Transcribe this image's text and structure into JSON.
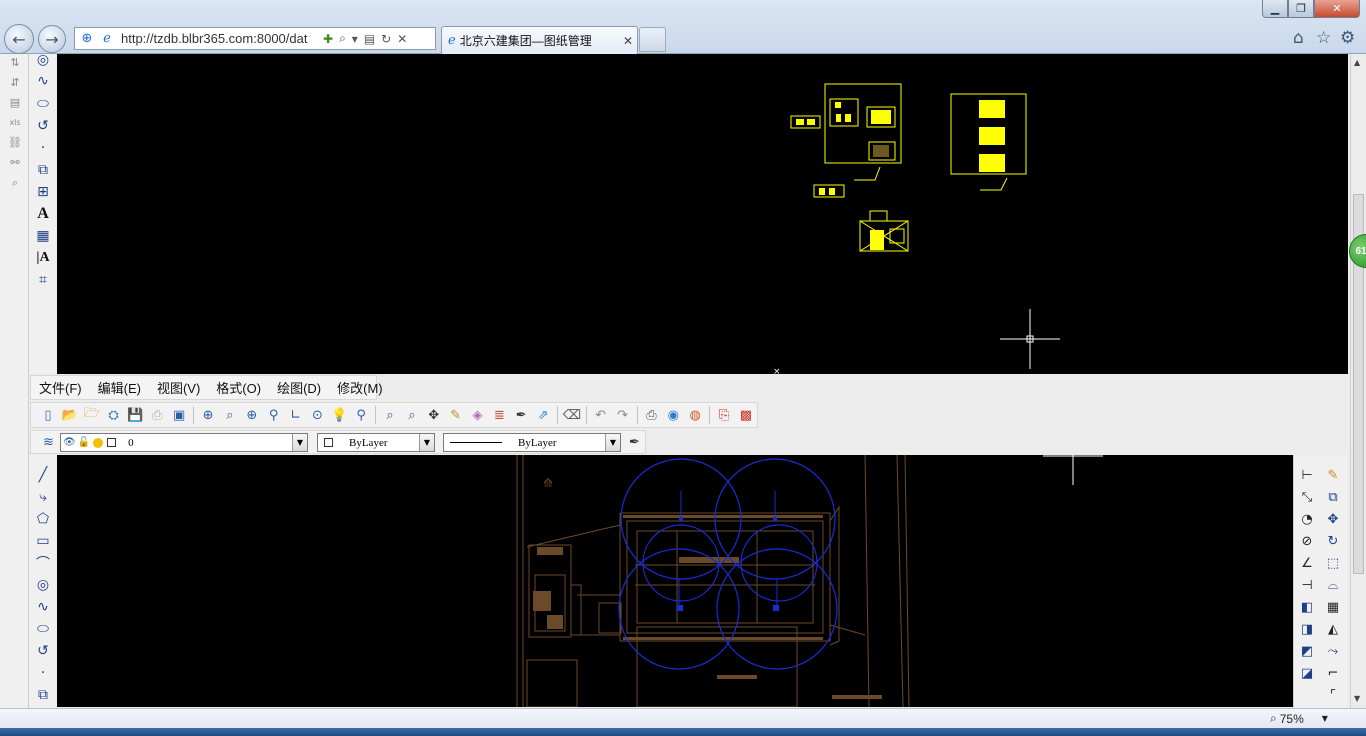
{
  "browser": {
    "url": "http://tzdb.blbr365.com:8000/dat",
    "tab_title": "北京六建集团—图纸管理",
    "zoom": "75%",
    "colors": {
      "frame": "#c9d8ea",
      "close_button": "#c74a2f"
    }
  },
  "menu": {
    "items": [
      "文件(F)",
      "编辑(E)",
      "视图(V)",
      "格式(O)",
      "绘图(D)",
      "修改(M)"
    ]
  },
  "layer_toolbar": {
    "layer_name": "0",
    "color_value": "ByLayer",
    "linetype_value": "ByLayer"
  },
  "canvas": {
    "background": "#000000",
    "yellow_entities": "#ffff00",
    "blue_circles": "#1a2cd9",
    "brown_plan": "#6b4a2a"
  },
  "icons": {
    "strip": [
      "sort-icon",
      "sort-desc-icon",
      "document-icon",
      "xls-icon",
      "link-icon",
      "unlink-icon",
      "zoom-icon"
    ]
  }
}
